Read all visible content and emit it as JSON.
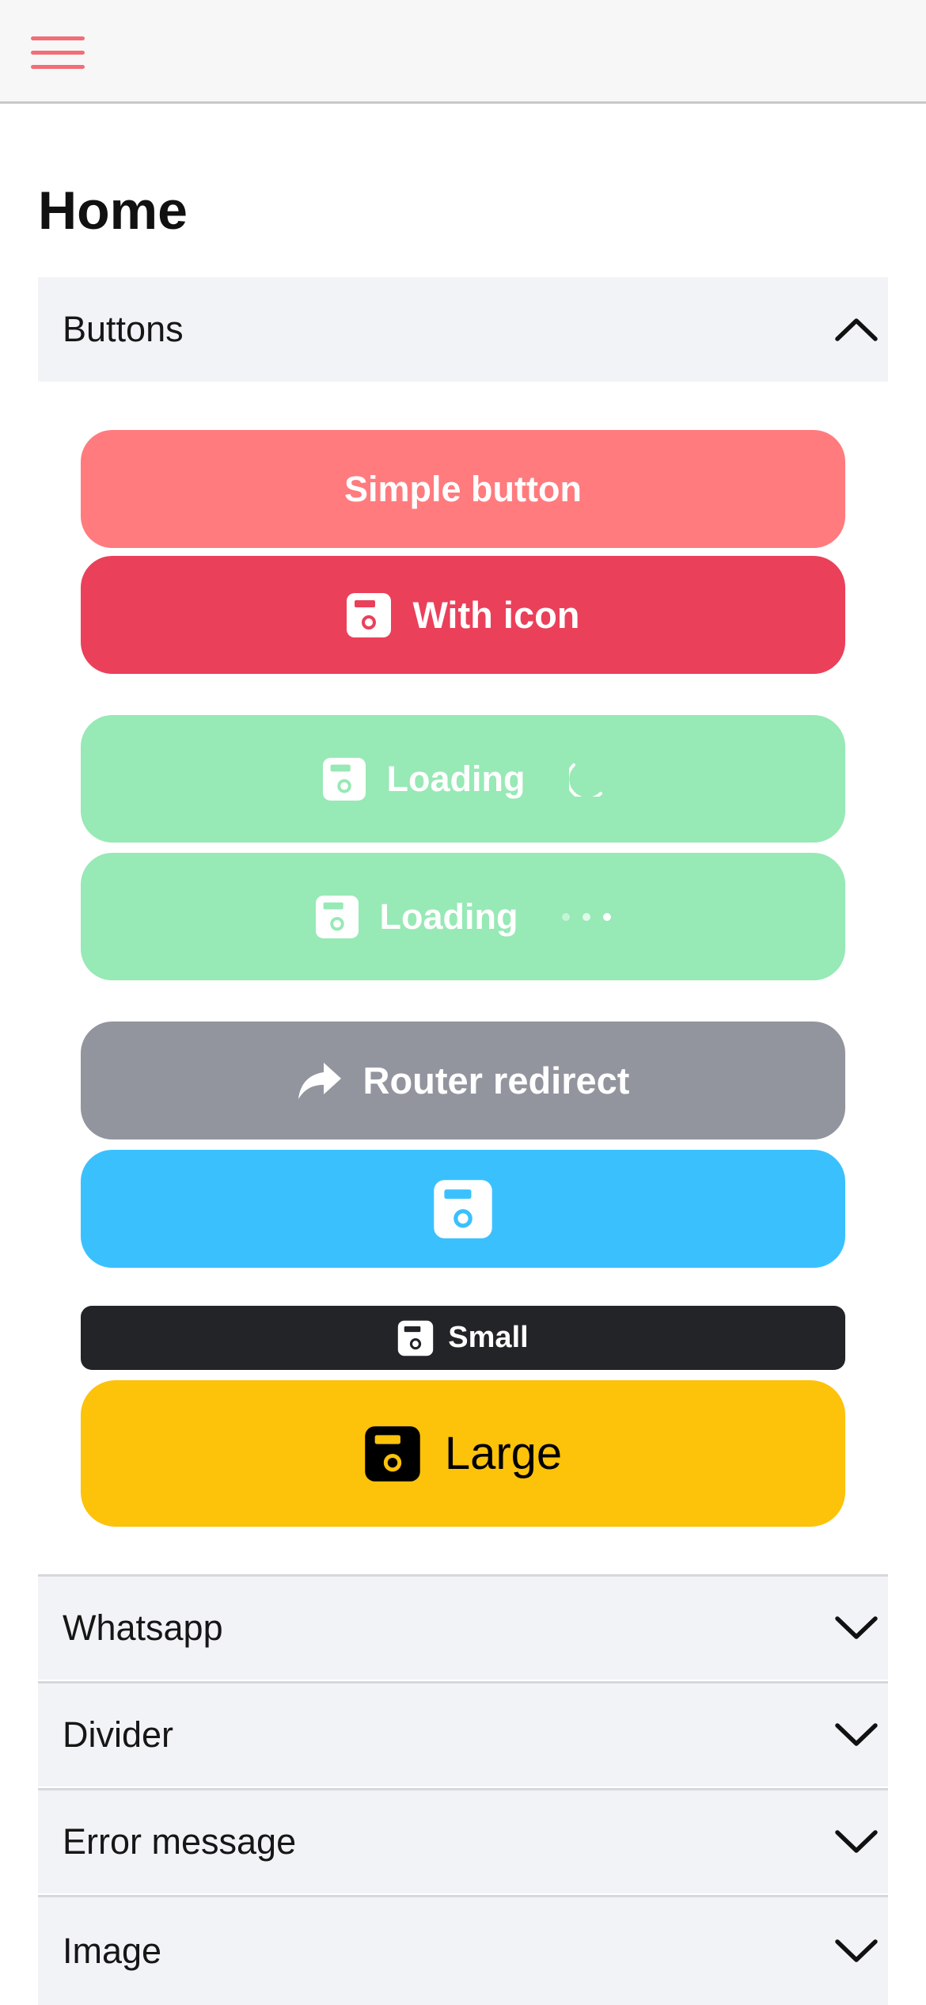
{
  "header": {
    "menu_icon": "hamburger-menu-icon",
    "accent": "#f26d77"
  },
  "page": {
    "title": "Home"
  },
  "accordion": {
    "open_section": {
      "label": "Buttons",
      "icon": "chevron-up-icon"
    },
    "buttons": [
      {
        "label": "Simple button",
        "color": "#ff7b7e"
      },
      {
        "label": "With icon",
        "icon": "save-icon",
        "color": "#eb405a"
      },
      {
        "label": "Loading",
        "icon": "save-icon",
        "indicator": "spinner",
        "color": "#97e9b5"
      },
      {
        "label": "Loading",
        "icon": "save-icon",
        "indicator": "dots",
        "color": "#97e9b5"
      },
      {
        "label": "Router redirect",
        "icon": "share-arrow-icon",
        "color": "#92959e"
      },
      {
        "label": "",
        "icon": "save-icon",
        "color": "#3bc0fe"
      },
      {
        "label": "Small",
        "icon": "save-icon",
        "color": "#232428"
      },
      {
        "label": "Large",
        "icon": "save-icon",
        "color": "#fdc20a"
      }
    ],
    "sections": [
      {
        "label": "Whatsapp",
        "icon": "chevron-down-icon"
      },
      {
        "label": "Divider",
        "icon": "chevron-down-icon"
      },
      {
        "label": "Error message",
        "icon": "chevron-down-icon"
      },
      {
        "label": "Image",
        "icon": "chevron-down-icon"
      }
    ]
  }
}
